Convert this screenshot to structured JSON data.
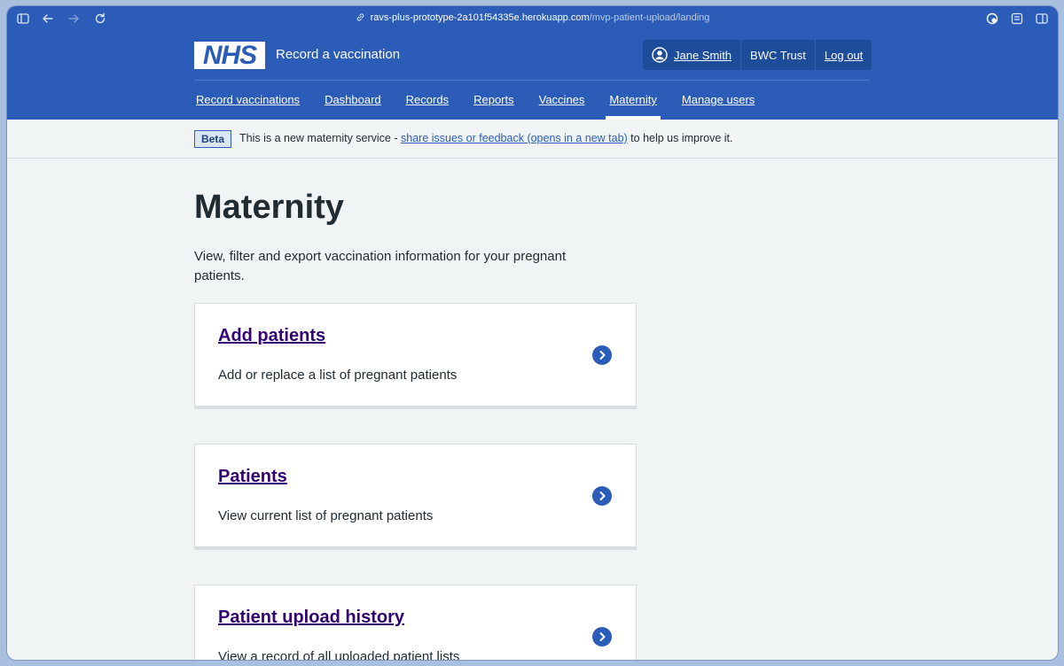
{
  "browser": {
    "url_host": "ravs-plus-prototype-2a101f54335e.herokuapp.com",
    "url_path": "/mvp-patient-upload/landing"
  },
  "header": {
    "logo_text": "NHS",
    "service_name": "Record a vaccination",
    "account": {
      "user_name": "Jane Smith",
      "organisation": "BWC Trust",
      "logout_label": "Log out"
    },
    "nav": [
      {
        "label": "Record vaccinations"
      },
      {
        "label": "Dashboard"
      },
      {
        "label": "Records"
      },
      {
        "label": "Reports"
      },
      {
        "label": "Vaccines"
      },
      {
        "label": "Maternity"
      },
      {
        "label": "Manage users"
      }
    ],
    "active_nav": "Maternity"
  },
  "banner": {
    "tag": "Beta",
    "text_before": "This is a new maternity service - ",
    "link": "share issues or feedback (opens in a new tab)",
    "text_after": " to help us improve it."
  },
  "main": {
    "title": "Maternity",
    "lede": "View, filter and export vaccination information for your pregnant patients.",
    "cards": [
      {
        "title": "Add patients",
        "description": "Add or replace a list of pregnant patients"
      },
      {
        "title": "Patients",
        "description": "View current list of pregnant patients"
      },
      {
        "title": "Patient upload history",
        "description": "View a record of all uploaded patient lists"
      }
    ]
  },
  "colors": {
    "nhs_blue": "#2b5db8",
    "link_visited": "#330072",
    "background": "#f0f4f5",
    "text": "#212b32"
  }
}
